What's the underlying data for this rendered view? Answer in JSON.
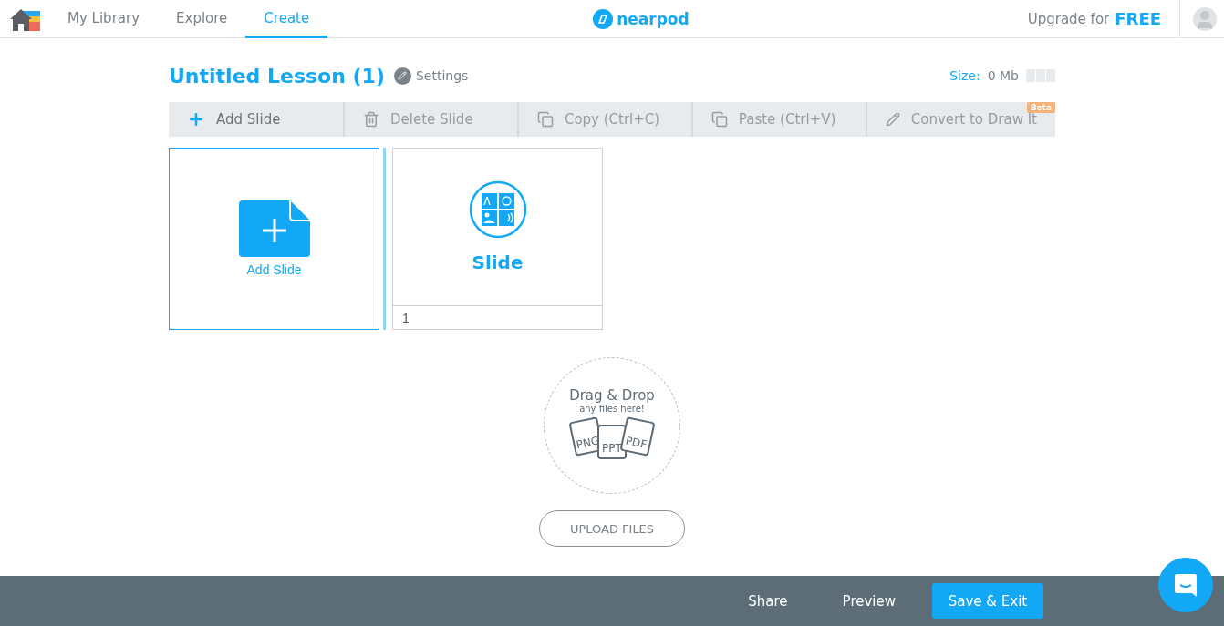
{
  "nav": {
    "tabs": [
      {
        "label": "My Library",
        "selected": false
      },
      {
        "label": "Explore",
        "selected": false
      },
      {
        "label": "Create",
        "selected": true
      }
    ],
    "logo": "nearpod",
    "upgrade": {
      "text": "Upgrade for",
      "highlight": "FREE"
    }
  },
  "lesson": {
    "title": "Untitled Lesson (1)",
    "settings": "Settings",
    "size_label": "Size:",
    "size_value": "0 Mb"
  },
  "toolbar": [
    {
      "kind": "add",
      "label": "Add Slide",
      "disabled": false
    },
    {
      "kind": "delete",
      "label": "Delete Slide",
      "disabled": true
    },
    {
      "kind": "copy",
      "label": "Copy (Ctrl+C)",
      "disabled": true
    },
    {
      "kind": "paste",
      "label": "Paste (Ctrl+V)",
      "disabled": true
    },
    {
      "kind": "draw",
      "label": "Convert to Draw It",
      "disabled": true,
      "badge": "Beta"
    }
  ],
  "add_card": {
    "label": "Add Slide"
  },
  "slides": [
    {
      "title": "Slide",
      "number": "1",
      "selected": false
    }
  ],
  "dropzone": {
    "title": "Drag & Drop",
    "subtitle": "any files here!",
    "files": [
      "PNG",
      "PPT",
      "PDF"
    ],
    "button": "UPLOAD FILES"
  },
  "footer": {
    "actions": [
      "Share",
      "Preview"
    ],
    "primary": "Save & Exit"
  }
}
